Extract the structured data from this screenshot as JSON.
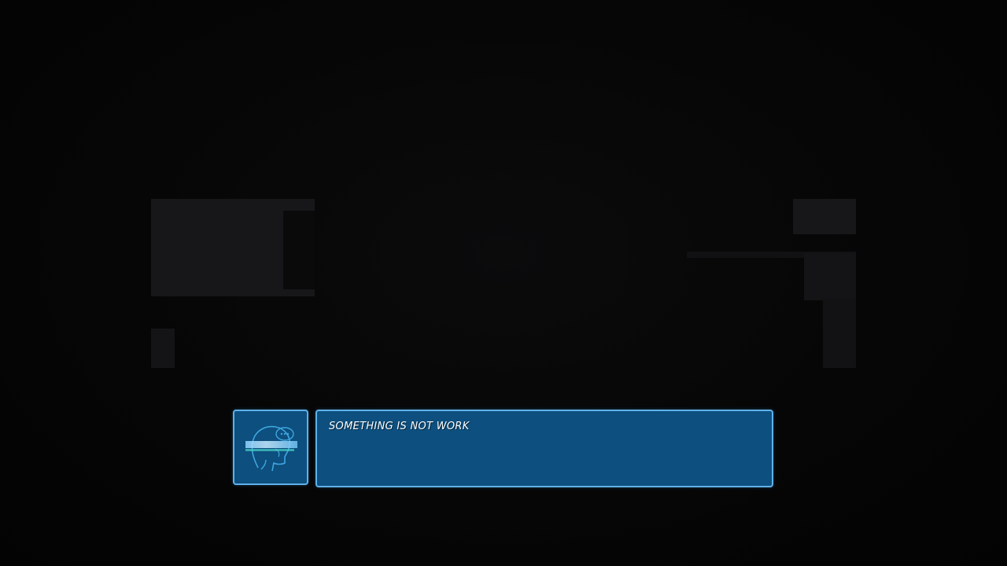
{
  "dialogue": {
    "text": "SOMETHING IS NOT WORK",
    "portrait_icon": "glitched-head-icon"
  },
  "colors": {
    "panel": "#0d4f7e",
    "border": "#5fb1e8",
    "background": "#050505"
  }
}
